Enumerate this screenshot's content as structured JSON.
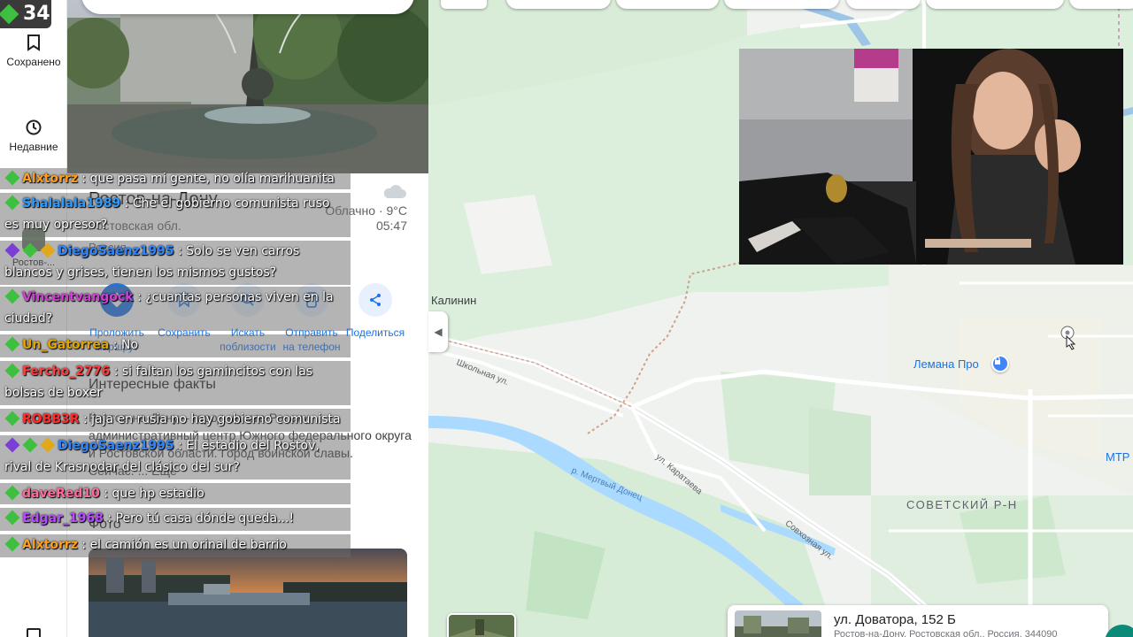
{
  "stream": {
    "viewer_count": "34",
    "chat": [
      {
        "user": "Alxtorrz",
        "user_color": "#ff9f1a",
        "text": "que pasa mi gente, no olía marihuanita",
        "badges": [
          "#3fbf3f"
        ]
      },
      {
        "user": "Shalalala1989",
        "user_color": "#2e9bff",
        "text": "Che el gobierno comunista ruso es muy opresor?",
        "badges": [
          "#3fbf3f"
        ]
      },
      {
        "user": "DiegoSaenz1995",
        "user_color": "#2e86ff",
        "text": "Solo se ven carros blancos y grises, tienen los mismos gustos?",
        "badges": [
          "#7c3fd6",
          "#3fbf3f",
          "#e0a81a"
        ]
      },
      {
        "user": "Vincentvangock",
        "user_color": "#d23fd6",
        "text": "¿cuantas personas viven en la ciudad?",
        "badges": [
          "#3fbf3f"
        ]
      },
      {
        "user": "Un_Gatorrea",
        "user_color": "#e2a500",
        "text": "No",
        "badges": [
          "#3fbf3f"
        ]
      },
      {
        "user": "Fercho_2776",
        "user_color": "#ff3f3f",
        "text": "si faltan los gamincitos con las bolsas de boxer",
        "badges": [
          "#3fbf3f"
        ]
      },
      {
        "user": "ROBB3R",
        "user_color": "#ff2d2d",
        "text": "jaja en rusia no hay gobierno comunista",
        "badges": [
          "#3fbf3f"
        ]
      },
      {
        "user": "DiegoSaenz1995",
        "user_color": "#2e86ff",
        "text": "El estadio del Rostov, rival de Krasnodar del clásico del sur?",
        "badges": [
          "#7c3fd6",
          "#3fbf3f",
          "#e0a81a"
        ]
      },
      {
        "user": "daveRed10",
        "user_color": "#ff6a9a",
        "text": "que hp estadio",
        "badges": [
          "#3fbf3f"
        ]
      },
      {
        "user": "Edgar_1968",
        "user_color": "#b84dff",
        "text": "Pero tú casa dónde queda...!",
        "badges": [
          "#3fbf3f"
        ]
      },
      {
        "user": "Alxtorrz",
        "user_color": "#ff9f1a",
        "text": "el camión es un orinal de barrio",
        "badges": [
          "#3fbf3f"
        ]
      }
    ]
  },
  "rail": {
    "saved_label": "Сохранено",
    "recent_label": "Недавние",
    "recent_place_label": "Ростов-..."
  },
  "place": {
    "title": "Ростов-на-Дону",
    "region": "Ростовская обл.",
    "country": "Россия",
    "weather": "Облачно · 9°C",
    "time": "05:47",
    "actions": [
      {
        "label": "Проложить маршрут",
        "icon": "directions-icon"
      },
      {
        "label": "Сохранить",
        "icon": "bookmark-icon"
      },
      {
        "label": "Искать поблизости",
        "icon": "nearby-search-icon"
      },
      {
        "label": "Отправить на телефон",
        "icon": "send-to-phone-icon"
      },
      {
        "label": "Поделиться",
        "icon": "share-icon"
      }
    ],
    "facts_title": "Интересные факты",
    "facts_text": "Ростов-на-Дону – город на юге России, административный центр Южного федерального округа и Ростовской области. Город воинской славы.",
    "facts_source": "Сейчас: ... Ещё",
    "photos_title": "Фото"
  },
  "map": {
    "labels": {
      "kalinin": "Калинин",
      "lemana": "Лемана Про",
      "sovetsky": "СОВЕТСКИЙ Р-Н",
      "mtr": "МТР",
      "shkolnaya": "Школьная ул.",
      "karataeva": "ул. Каратаева",
      "sovkhoznaya": "Совхозная ул.",
      "river": "р. Мертвый Донец"
    }
  },
  "address_card": {
    "title": "ул. Доватора, 152 Б",
    "subtitle": "Ростов-на-Дону, Ростовская обл., Россия, 344090"
  },
  "colors": {
    "accent": "#1a73e8",
    "water": "#aadaff",
    "park": "#c8ecd0"
  }
}
